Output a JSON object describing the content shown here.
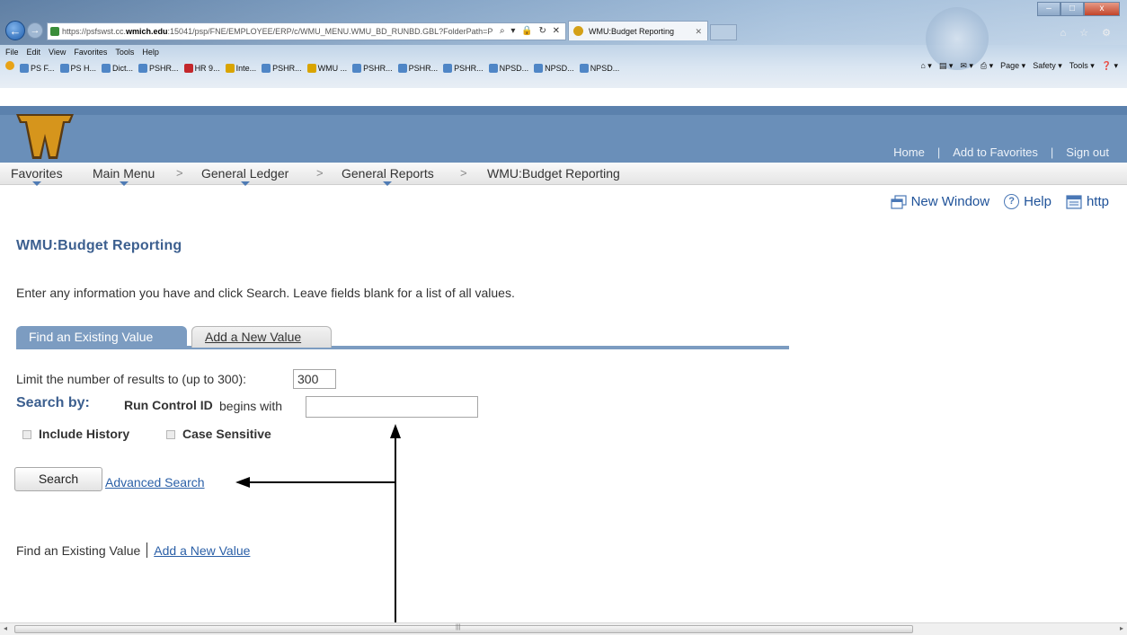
{
  "browser": {
    "address_prefix": "https://",
    "address_host_pre": "psfswst.cc.",
    "address_host": "wmich.edu",
    "address_rest": ":15041/psp/FNE/EMPLOYEE/ERP/c/WMU_MENU.WMU_BD_RUNBD.GBL?FolderPath=P",
    "address_tools": "⌕ ▾ 🔒 ↻ ✕",
    "tab_title": "WMU:Budget Reporting",
    "tab_close": "✕",
    "menu": [
      "File",
      "Edit",
      "View",
      "Favorites",
      "Tools",
      "Help"
    ],
    "favorites": [
      "PS F...",
      "PS H...",
      "Dict...",
      "PSHR...",
      "HR 9...",
      "Inte...",
      "PSHR...",
      "WMU ...",
      "PSHR...",
      "PSHR...",
      "PSHR...",
      "NPSD...",
      "NPSD...",
      "NPSD..."
    ],
    "commands": [
      "⌂ ▾",
      "▤ ▾",
      "✉ ▾",
      "⎙ ▾",
      "Page ▾",
      "Safety ▾",
      "Tools ▾",
      "❓ ▾"
    ],
    "window_controls": [
      "–",
      "□",
      "x"
    ],
    "right_icons": "⌂ ☆ ⚙"
  },
  "header": {
    "logo_letter": "W",
    "links": [
      "Home",
      "Add to Favorites",
      "Sign out"
    ]
  },
  "navbar": {
    "items": [
      "Favorites",
      "Main Menu",
      "General Ledger",
      "General Reports",
      "WMU:Budget Reporting"
    ],
    "separator": ">"
  },
  "pagetools": {
    "new_window": "New Window",
    "help": "Help",
    "help_glyph": "?",
    "http": "http"
  },
  "page": {
    "title": "WMU:Budget Reporting",
    "instruction": "Enter any information you have and click Search. Leave fields blank for a list of all values.",
    "tab_find": "Find an Existing Value",
    "tab_add": "Add a New Value",
    "limit_label": "Limit the number of results to (up to 300):",
    "limit_value": "300",
    "search_by": "Search by:",
    "field_label": "Run Control ID",
    "operator": "begins with",
    "run_control_value": "",
    "include_history": "Include History",
    "case_sensitive": "Case Sensitive",
    "search_button": "Search",
    "advanced_search": "Advanced Search",
    "bottom_find": "Find an Existing Value",
    "bottom_add": "Add a New Value"
  },
  "scrollbar": {
    "left": "◂",
    "right": "▸",
    "grip": "|||"
  },
  "colors": {
    "header_blue": "#6a8fb9",
    "title_blue": "#3c5f8f",
    "link_blue": "#2a5fa7",
    "logo_gold": "#d6951c",
    "logo_brown": "#5a3a12"
  }
}
